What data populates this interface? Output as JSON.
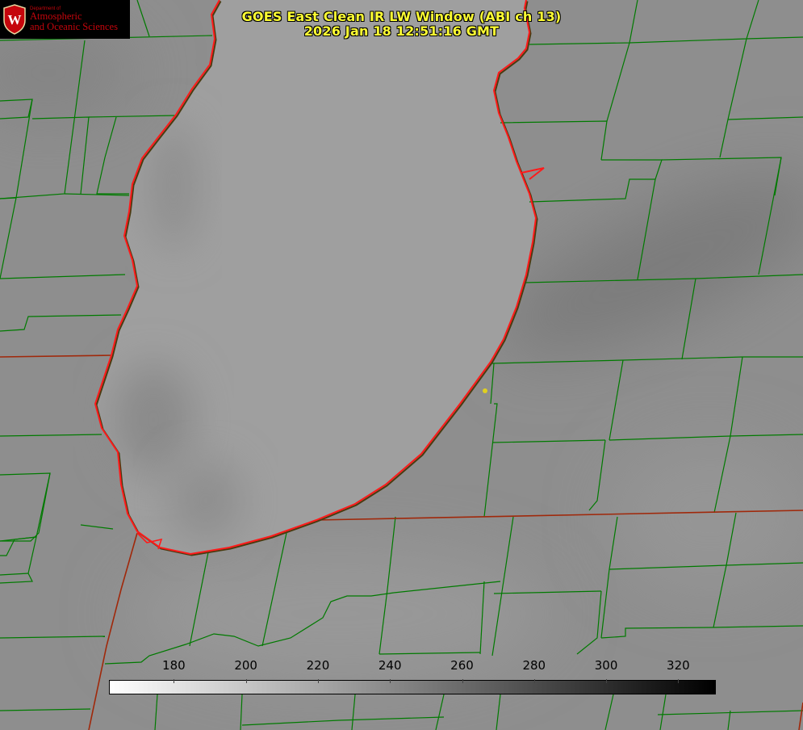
{
  "title": {
    "line1": "GOES East Clean IR LW Window (ABI ch 13)",
    "line2": "2026 Jan 18 12:51:16 GMT"
  },
  "logo": {
    "dept": "Department of",
    "line1": "Atmospheric",
    "line2": "and Oceanic Sciences",
    "crest_letter": "W",
    "color": "#c5050c"
  },
  "colorbar": {
    "min": 162,
    "max": 330,
    "ticks": [
      {
        "value": 180,
        "label": "180"
      },
      {
        "value": 200,
        "label": "200"
      },
      {
        "value": 220,
        "label": "220"
      },
      {
        "value": 240,
        "label": "240"
      },
      {
        "value": 260,
        "label": "260"
      },
      {
        "value": 280,
        "label": "280"
      },
      {
        "value": 300,
        "label": "300"
      },
      {
        "value": 320,
        "label": "320"
      }
    ],
    "low_color": "#ffffff",
    "high_color": "#000000"
  },
  "colors": {
    "background": "#8f8f8f",
    "lake": "#a0a0a0",
    "county_lines": "#007a00",
    "state_lines": "#a0280a",
    "shoreline": "#ff1a1a",
    "title": "#ffff33",
    "marker": "#e0d020"
  }
}
